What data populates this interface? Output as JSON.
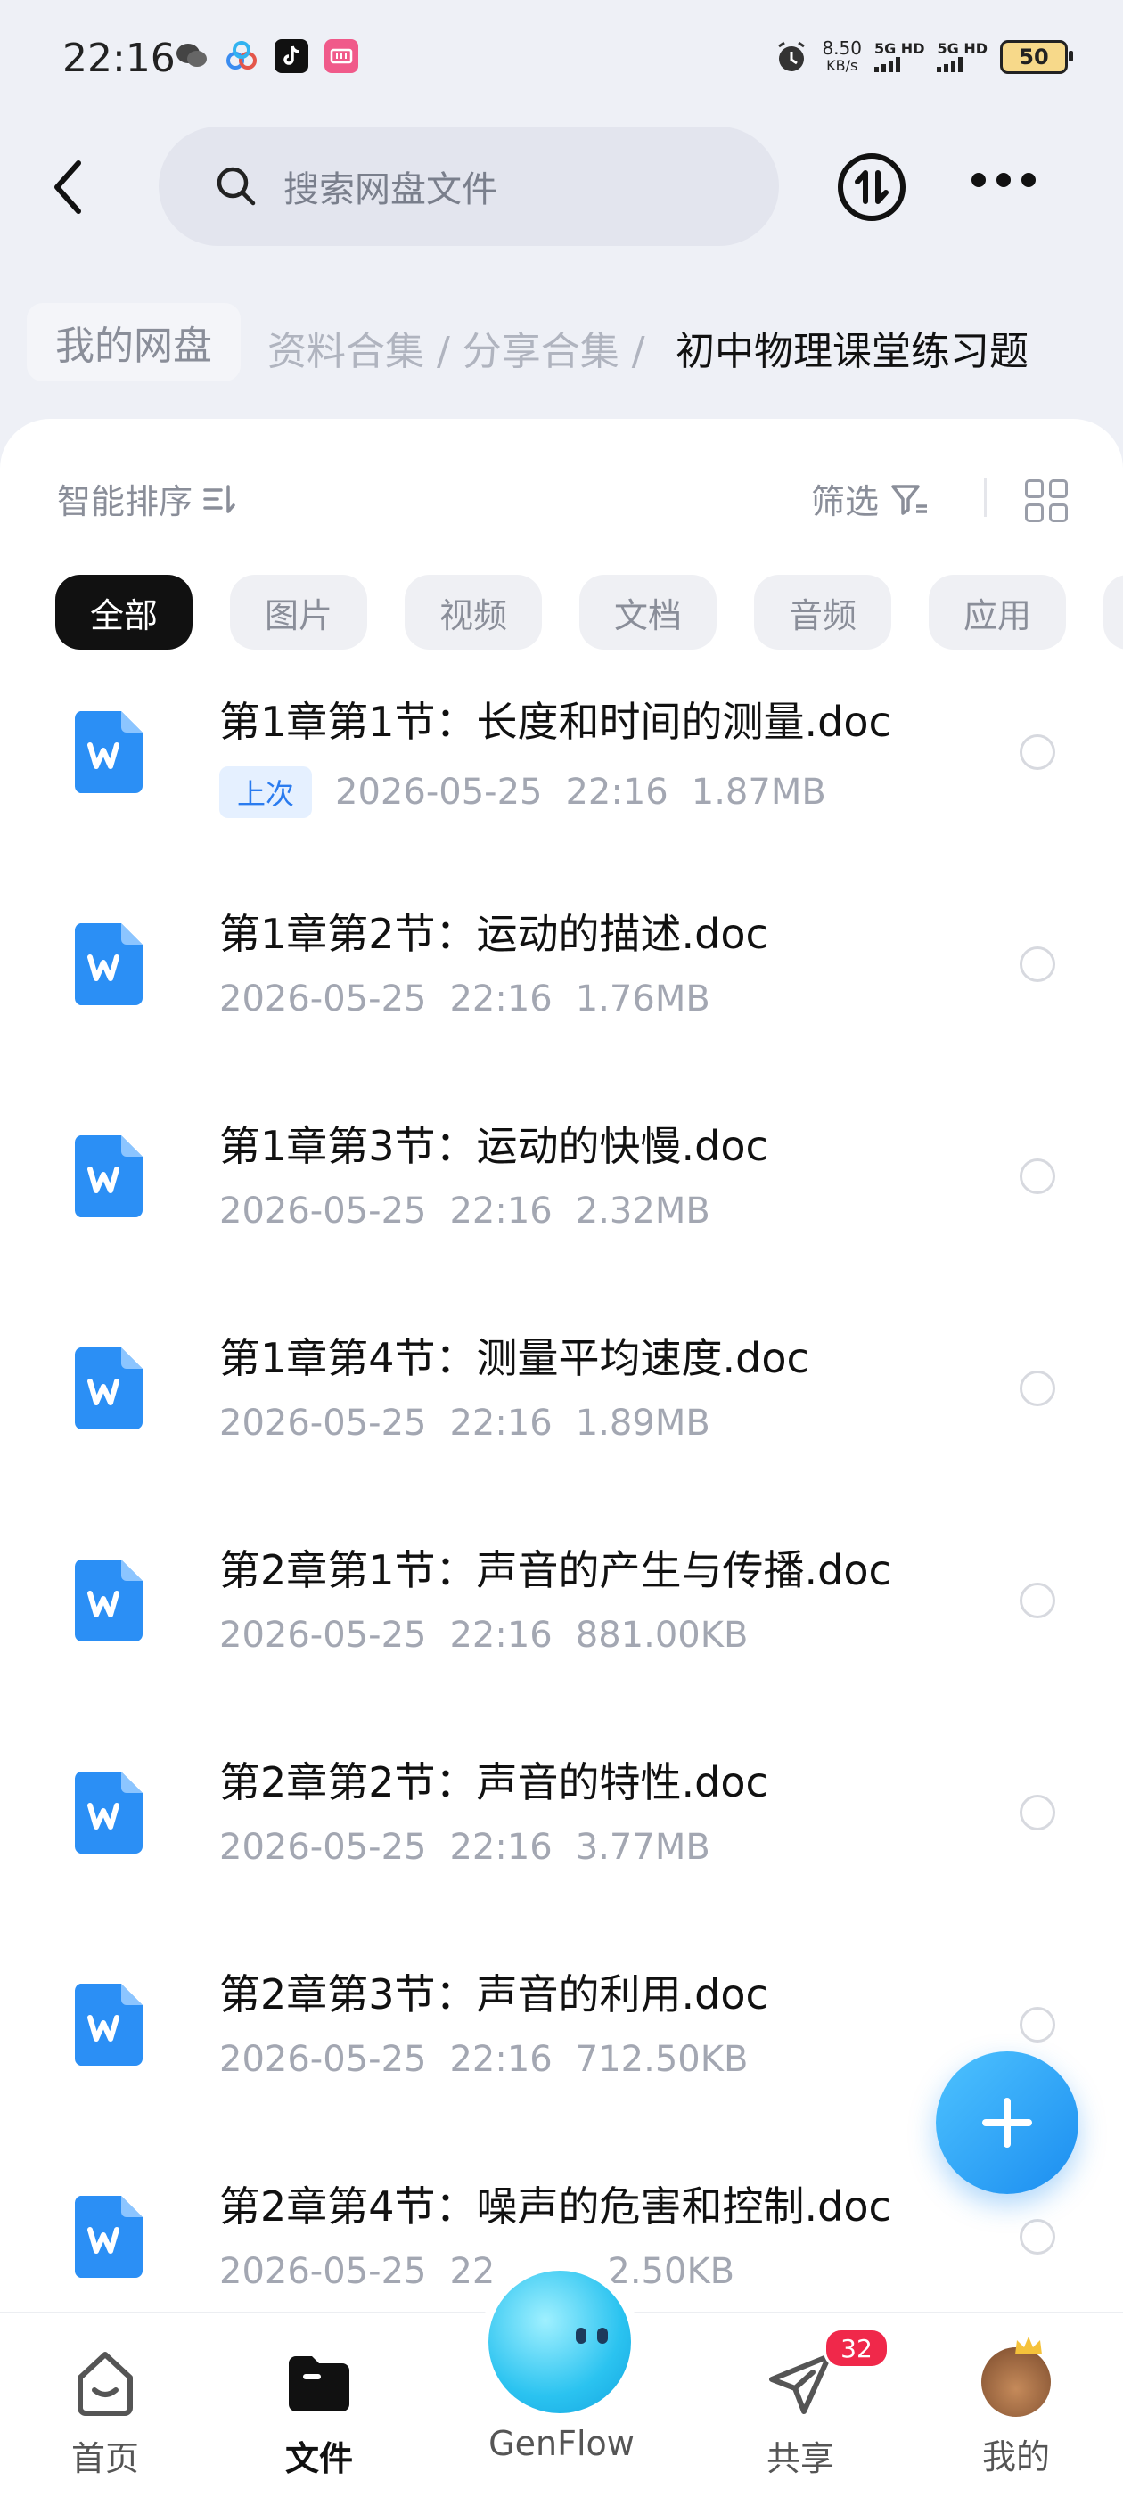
{
  "status_bar": {
    "time": "22:16",
    "speed_value": "8.50",
    "speed_unit": "KB/s",
    "net1": "5G HD",
    "net2": "5G HD",
    "battery": "50",
    "apps": [
      "wechat-icon",
      "baidu-netdisk-icon",
      "tiktok-icon",
      "reading-app-icon"
    ]
  },
  "header": {
    "search_placeholder": "搜索网盘文件",
    "icons": [
      "back-arrow-icon",
      "search-icon",
      "transfer-icon",
      "more-icon"
    ]
  },
  "breadcrumb": {
    "root": "我的网盘",
    "middle": "资料合集 / 分享合集 /",
    "current": "初中物理课堂练习题"
  },
  "toolbar": {
    "sort_label": "智能排序",
    "filter_label": "筛选"
  },
  "chips": [
    "全部",
    "图片",
    "视频",
    "文档",
    "音频",
    "应用"
  ],
  "files": [
    {
      "name": "第1章第1节：长度和时间的测量.doc",
      "tag": "上次",
      "date": "2026-05-25",
      "time": "22:16",
      "size": "1.87MB"
    },
    {
      "name": "第1章第2节：运动的描述.doc",
      "tag": "",
      "date": "2026-05-25",
      "time": "22:16",
      "size": "1.76MB"
    },
    {
      "name": "第1章第3节：运动的快慢.doc",
      "tag": "",
      "date": "2026-05-25",
      "time": "22:16",
      "size": "2.32MB"
    },
    {
      "name": "第1章第4节：测量平均速度.doc",
      "tag": "",
      "date": "2026-05-25",
      "time": "22:16",
      "size": "1.89MB"
    },
    {
      "name": "第2章第1节：声音的产生与传播.doc",
      "tag": "",
      "date": "2026-05-25",
      "time": "22:16",
      "size": "881.00KB"
    },
    {
      "name": "第2章第2节：声音的特性.doc",
      "tag": "",
      "date": "2026-05-25",
      "time": "22:16",
      "size": "3.77MB"
    },
    {
      "name": "第2章第3节：声音的利用.doc",
      "tag": "",
      "date": "2026-05-25",
      "time": "22:16",
      "size": "712.50KB"
    },
    {
      "name": "第2章第4节：噪声的危害和控制.doc",
      "tag": "",
      "date": "2026-05-25",
      "time": "22",
      "size": "2.50KB"
    }
  ],
  "bottom_nav": {
    "home": "首页",
    "files": "文件",
    "genflow": "GenFlow",
    "share": "共享",
    "share_badge": "32",
    "mine": "我的"
  },
  "colors": {
    "accent": "#2a7bef",
    "fab": "#1b8df0",
    "badge": "#f0284a",
    "file_icon": "#2b8ff5"
  }
}
